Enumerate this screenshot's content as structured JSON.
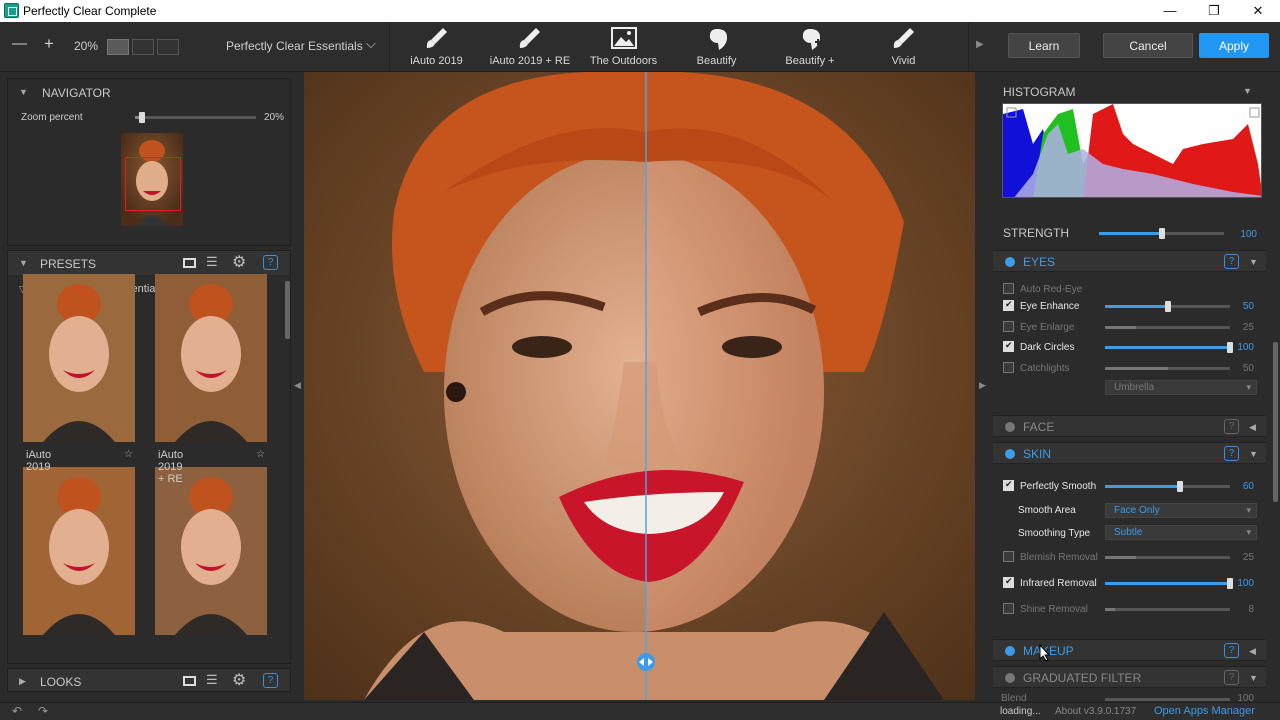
{
  "window": {
    "title": "Perfectly Clear Complete",
    "minimize": "—",
    "maximize": "❐",
    "close": "✕"
  },
  "toolbar": {
    "zoom_out": "—",
    "zoom_in": "+",
    "zoom_value": "20%",
    "preset_group": "Perfectly Clear Essentials",
    "presets": [
      {
        "label": "iAuto 2019",
        "icon": "brush-2019-icon"
      },
      {
        "label": "iAuto 2019 + RE",
        "icon": "brush-2019-re-icon"
      },
      {
        "label": "The Outdoors",
        "icon": "landscape-icon"
      },
      {
        "label": "Beautify",
        "icon": "face-icon"
      },
      {
        "label": "Beautify +",
        "icon": "face-plus-icon"
      },
      {
        "label": "Vivid",
        "icon": "brush-icon"
      }
    ],
    "learn": "Learn",
    "cancel": "Cancel",
    "apply": "Apply"
  },
  "navigator": {
    "title": "NAVIGATOR",
    "zoom_label": "Zoom percent",
    "zoom_value": "20%",
    "zoom_fraction": 0.06
  },
  "presets_panel": {
    "title": "PRESETS",
    "group": "Perfectly Clear Essentials",
    "thumbs": [
      {
        "label": "iAuto 2019"
      },
      {
        "label": "iAuto 2019 + RE"
      },
      {
        "label": ""
      },
      {
        "label": ""
      }
    ]
  },
  "looks": {
    "title": "LOOKS"
  },
  "histogram": {
    "title": "HISTOGRAM"
  },
  "strength": {
    "label": "STRENGTH",
    "value": "100",
    "fraction": 0.5
  },
  "eyes": {
    "title": "EYES",
    "rows": [
      {
        "label": "Auto Red-Eye",
        "checked": false,
        "enabled": false
      },
      {
        "label": "Eye Enhance",
        "checked": true,
        "enabled": true,
        "value": "50",
        "fraction": 0.5
      },
      {
        "label": "Eye Enlarge",
        "checked": false,
        "enabled": false,
        "value": "25",
        "fraction": 0.25
      },
      {
        "label": "Dark Circles",
        "checked": true,
        "enabled": true,
        "value": "100",
        "fraction": 1.0
      },
      {
        "label": "Catchlights",
        "checked": false,
        "enabled": false,
        "value": "50",
        "fraction": 0.5
      }
    ],
    "catchlight_option": "Umbrella"
  },
  "face": {
    "title": "FACE"
  },
  "skin": {
    "title": "SKIN",
    "perfectly_smooth": {
      "label": "Perfectly Smooth",
      "value": "60",
      "fraction": 0.6
    },
    "smooth_area": {
      "label": "Smooth Area",
      "value": "Face Only"
    },
    "smoothing_type": {
      "label": "Smoothing Type",
      "value": "Subtle"
    },
    "blemish": {
      "label": "Blemish Removal",
      "value": "25",
      "fraction": 0.25
    },
    "infrared": {
      "label": "Infrared Removal",
      "value": "100",
      "fraction": 1.0
    },
    "shine": {
      "label": "Shine Removal",
      "value": "8",
      "fraction": 0.08
    }
  },
  "makeup": {
    "title": "MAKEUP"
  },
  "graduated": {
    "title": "GRADUATED FILTER",
    "partial": "Blend",
    "partial_value": "100"
  },
  "status": {
    "loading": "loading...",
    "about": "About v3.9.0.1737",
    "apps_manager": "Open Apps Manager"
  },
  "colors": {
    "accent": "#2196f3",
    "slider": "#3d9be9",
    "enabled_dot": "#3d9be9",
    "disabled_dot": "#777777"
  }
}
